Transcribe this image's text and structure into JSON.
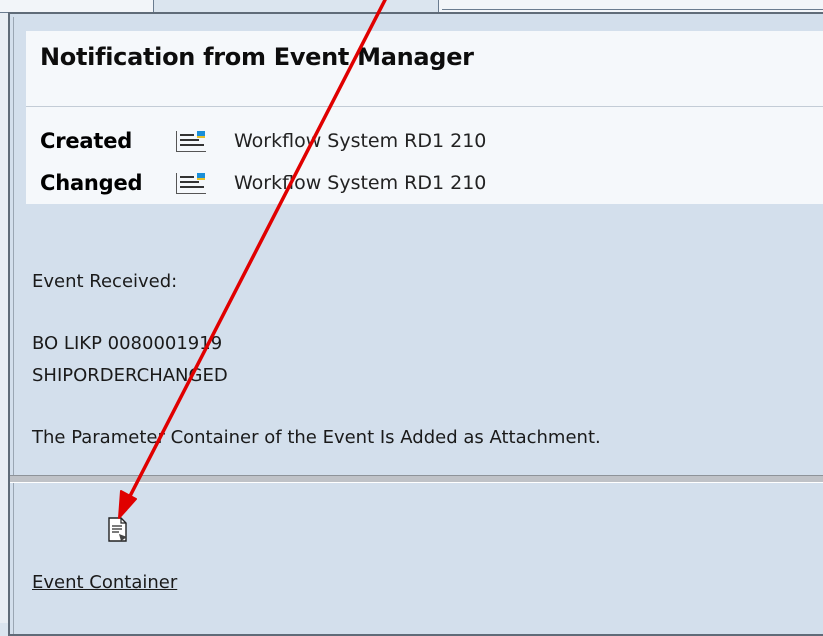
{
  "notification": {
    "title": "Notification from Event Manager"
  },
  "meta": {
    "created_label": "Created",
    "created_value": "Workflow System RD1 210",
    "changed_label": "Changed",
    "changed_value": "Workflow System RD1 210"
  },
  "body": {
    "line1": "Event Received:",
    "line2": "BO LIKP 0080001919",
    "line3": "SHIPORDERCHANGED",
    "line4": "The Parameter Container of the Event Is Added as Attachment."
  },
  "attachment": {
    "label": "Event Container",
    "icon": "document-icon"
  },
  "icons": {
    "meta_icon": "user-card-icon"
  },
  "colors": {
    "arrow": "#e00000",
    "background": "#d3dfec",
    "band": "#f5f8fb"
  }
}
